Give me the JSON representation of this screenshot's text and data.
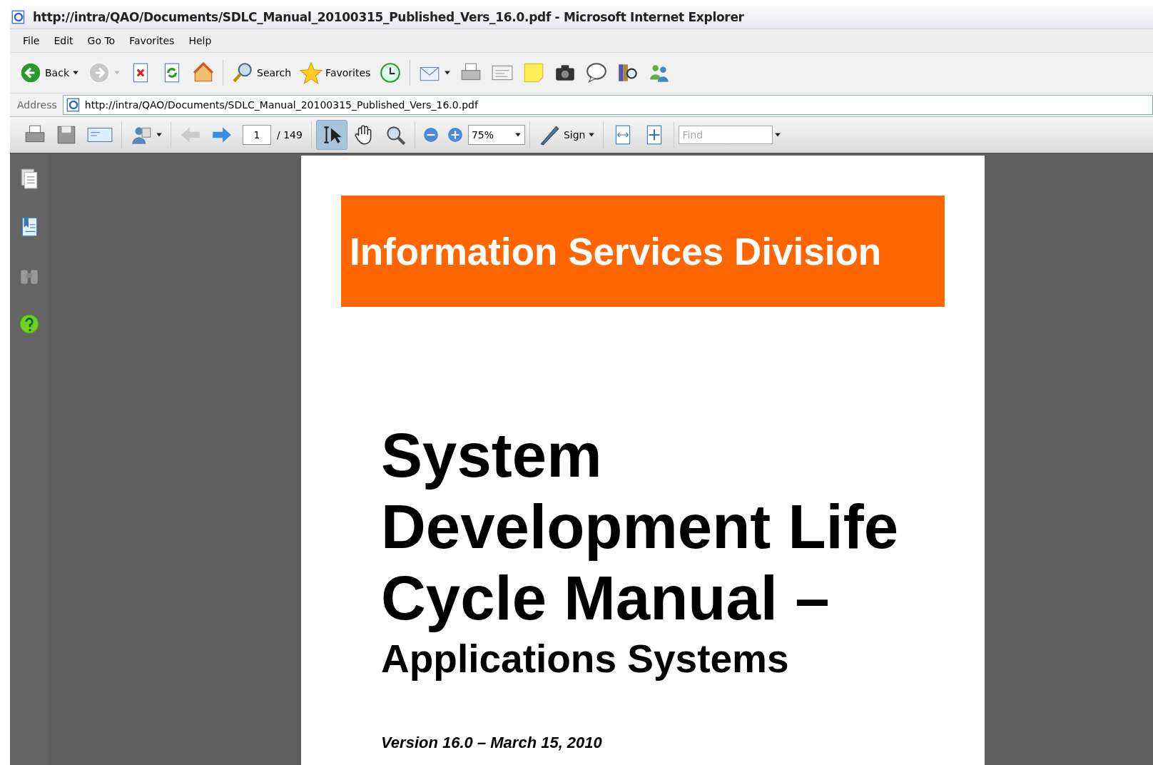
{
  "window": {
    "title": "http://intra/QAO/Documents/SDLC_Manual_20100315_Published_Vers_16.0.pdf - Microsoft Internet Explorer"
  },
  "menu": [
    "File",
    "Edit",
    "Go To",
    "Favorites",
    "Help"
  ],
  "toolbar": [
    {
      "kind": "back",
      "label": "Back",
      "dropdown": true
    },
    {
      "kind": "forward",
      "dropdown": true
    },
    {
      "kind": "stop"
    },
    {
      "kind": "refresh"
    },
    {
      "kind": "home"
    },
    {
      "kind": "search",
      "label": "Search"
    },
    {
      "kind": "favorites",
      "label": "Favorites"
    },
    {
      "kind": "history"
    },
    {
      "kind": "mail",
      "dropdown": true
    },
    {
      "kind": "print"
    },
    {
      "kind": "edit"
    },
    {
      "kind": "note"
    },
    {
      "kind": "camera"
    },
    {
      "kind": "messenger"
    },
    {
      "kind": "research"
    },
    {
      "kind": "contacts"
    }
  ],
  "address": {
    "label": "Address",
    "value": "http://intra/QAO/Documents/SDLC_Manual_20100315_Published_Vers_16.0.pdf"
  },
  "pdf_toolbar": {
    "page": "1",
    "page_total": "/ 149",
    "zoom": "75%",
    "sign": "Sign",
    "find_placeholder": "Find",
    "tools": [
      {
        "kind": "select",
        "selected": true
      },
      {
        "kind": "hand",
        "selected": false
      },
      {
        "kind": "zoom",
        "selected": false
      }
    ]
  },
  "sidebar": [
    {
      "kind": "pages"
    },
    {
      "kind": "bookmarks"
    },
    {
      "kind": "find"
    },
    {
      "kind": "help"
    }
  ],
  "document": {
    "banner": "Information Services Division",
    "title_lines": [
      "System",
      "Development Life",
      "Cycle Manual –"
    ],
    "subtitle": "Applications Systems",
    "version": "Version 16.0 – March 15, 2010"
  }
}
